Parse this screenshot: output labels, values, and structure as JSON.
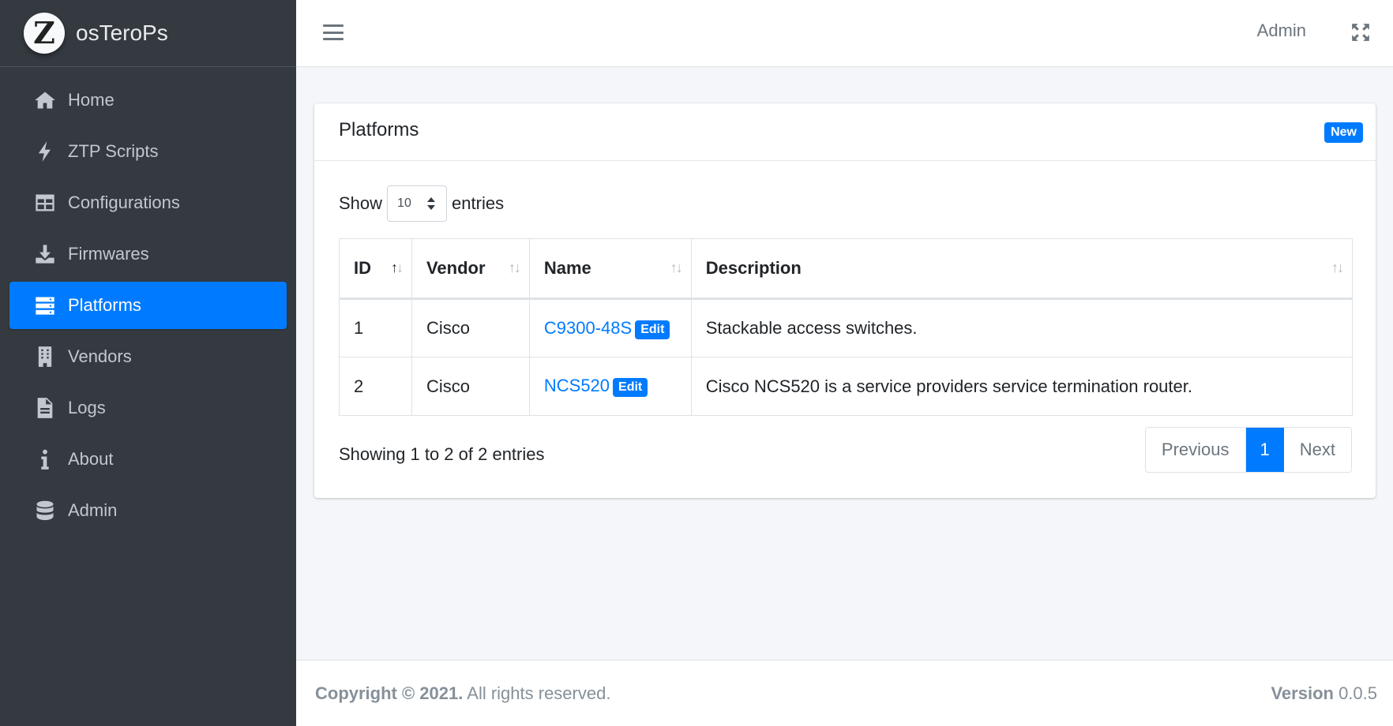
{
  "brand": {
    "logo_letter": "Z",
    "name": "osTeroPs"
  },
  "sidebar": {
    "items": [
      {
        "label": "Home",
        "icon": "home-icon"
      },
      {
        "label": "ZTP Scripts",
        "icon": "bolt-icon"
      },
      {
        "label": "Configurations",
        "icon": "table-icon"
      },
      {
        "label": "Firmwares",
        "icon": "download-icon"
      },
      {
        "label": "Platforms",
        "icon": "server-icon",
        "active": true
      },
      {
        "label": "Vendors",
        "icon": "building-icon"
      },
      {
        "label": "Logs",
        "icon": "file-icon"
      },
      {
        "label": "About",
        "icon": "info-icon"
      },
      {
        "label": "Admin",
        "icon": "database-icon"
      }
    ]
  },
  "topbar": {
    "user": "Admin"
  },
  "card": {
    "title": "Platforms",
    "new_label": "New",
    "length": {
      "show": "Show",
      "value": "10",
      "entries": "entries"
    },
    "table": {
      "headers": [
        "ID",
        "Vendor",
        "Name",
        "Description"
      ],
      "edit_label": "Edit",
      "rows": [
        {
          "id": "1",
          "vendor": "Cisco",
          "name": "C9300-48S",
          "description": "Stackable access switches."
        },
        {
          "id": "2",
          "vendor": "Cisco",
          "name": "NCS520",
          "description": "Cisco NCS520 is a service providers service termination router."
        }
      ]
    },
    "info": "Showing 1 to 2 of 2 entries",
    "pagination": {
      "previous": "Previous",
      "current": "1",
      "next": "Next"
    }
  },
  "footer": {
    "copyright_bold": "Copyright © 2021.",
    "copyright_rest": " All rights reserved.",
    "version_label": "Version",
    "version_value": " 0.0.5"
  },
  "colors": {
    "sidebar": "#343a40",
    "accent": "#007bff",
    "background": "#f4f6f9"
  }
}
